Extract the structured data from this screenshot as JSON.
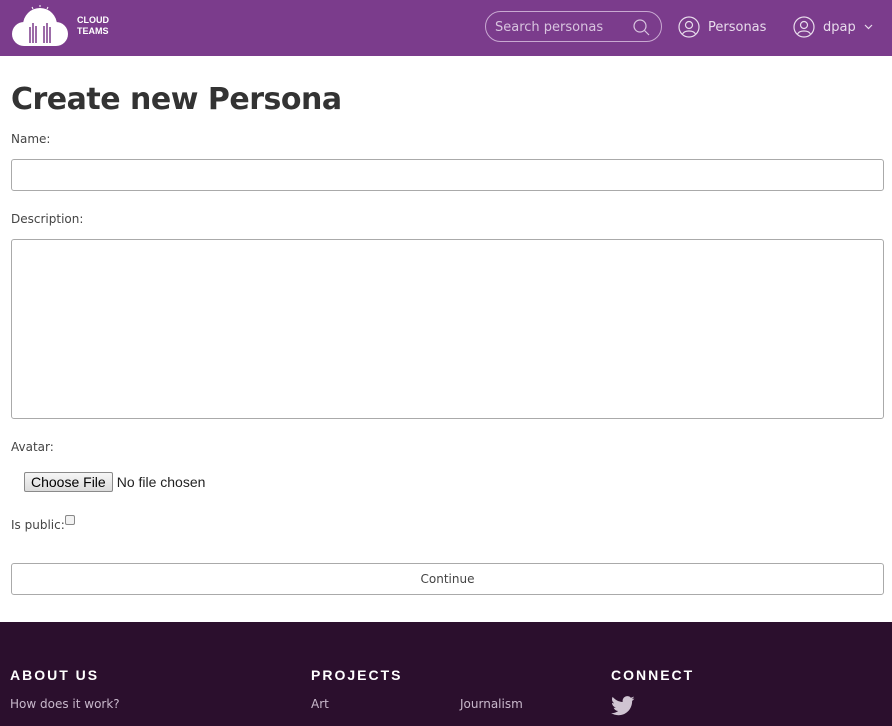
{
  "header": {
    "logo_line1": "CLOUD",
    "logo_line2": "TEAMS",
    "search_placeholder": "Search personas",
    "nav_personas": "Personas",
    "nav_user": "dpap"
  },
  "form": {
    "title": "Create new Persona",
    "name_label": "Name:",
    "name_value": "",
    "description_label": "Description:",
    "description_value": "",
    "avatar_label": "Avatar:",
    "file_button": "Choose File",
    "file_status": "No file chosen",
    "public_label": "Is public:",
    "is_public": false,
    "continue_label": "Continue"
  },
  "footer": {
    "about_heading": "ABOUT US",
    "about_links": [
      "How does it work?"
    ],
    "projects_heading": "PROJECTS",
    "projects_links": [
      "Art",
      "Journalism"
    ],
    "connect_heading": "CONNECT",
    "connect_icons": [
      "twitter-icon"
    ]
  },
  "colors": {
    "header_bg": "#7b3c8c",
    "footer_bg": "#2b0f2d",
    "title_text": "#333333"
  }
}
